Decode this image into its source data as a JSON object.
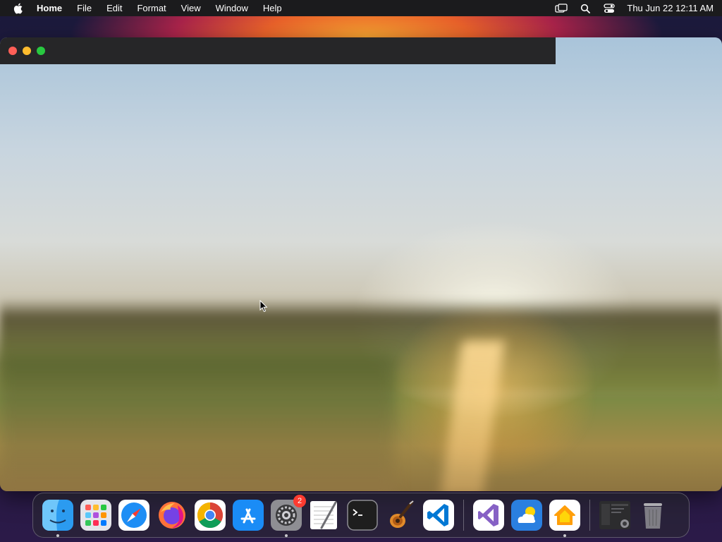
{
  "menubar": {
    "app_name": "Home",
    "menus": [
      "File",
      "Edit",
      "Format",
      "View",
      "Window",
      "Help"
    ],
    "clock": "Thu Jun 22  12:11 AM",
    "status_icons": [
      "screen-mirroring-icon",
      "spotlight-search-icon",
      "control-center-icon"
    ]
  },
  "window": {
    "title": "",
    "traffic_lights": [
      "close",
      "minimize",
      "zoom"
    ]
  },
  "dock": {
    "apps": [
      {
        "name": "Finder",
        "icon": "finder-icon",
        "running": true
      },
      {
        "name": "Launchpad",
        "icon": "launchpad-icon",
        "running": false
      },
      {
        "name": "Safari",
        "icon": "safari-icon",
        "running": false
      },
      {
        "name": "Firefox",
        "icon": "firefox-icon",
        "running": false
      },
      {
        "name": "Google Chrome",
        "icon": "chrome-icon",
        "running": false
      },
      {
        "name": "App Store",
        "icon": "app-store-icon",
        "running": false
      },
      {
        "name": "System Settings",
        "icon": "system-settings-icon",
        "running": true,
        "badge": "2"
      },
      {
        "name": "TextEdit",
        "icon": "textedit-icon",
        "running": false
      },
      {
        "name": "Terminal",
        "icon": "terminal-icon",
        "running": false
      },
      {
        "name": "GarageBand",
        "icon": "garageband-icon",
        "running": false
      },
      {
        "name": "Visual Studio Code",
        "icon": "vscode-icon",
        "running": false
      },
      {
        "name": "Visual Studio",
        "icon": "visual-studio-icon",
        "running": false
      },
      {
        "name": "Weather",
        "icon": "weather-icon",
        "running": false
      },
      {
        "name": "Home",
        "icon": "home-app-icon",
        "running": true
      },
      {
        "name": "Recent Window",
        "icon": "recent-window-icon",
        "running": false
      },
      {
        "name": "Trash",
        "icon": "trash-icon",
        "running": false
      }
    ]
  },
  "colors": {
    "menubar_bg": "#1b1b1d",
    "titlebar_bg": "#262628",
    "close": "#ff5f57",
    "minimize": "#febc2e",
    "zoom": "#28c840",
    "badge": "#ff3b30"
  }
}
